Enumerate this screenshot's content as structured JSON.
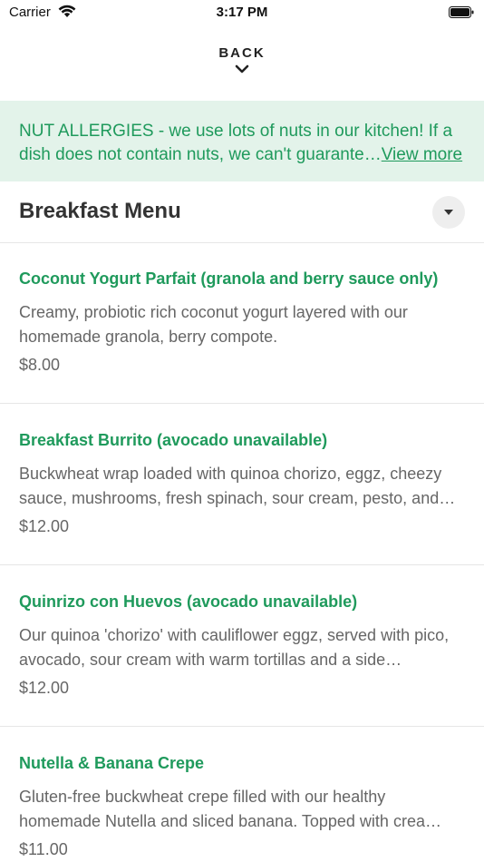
{
  "status_bar": {
    "carrier": "Carrier",
    "time": "3:17 PM"
  },
  "nav": {
    "back_label": "BACK"
  },
  "notice": {
    "text": "NUT ALLERGIES - we use lots of nuts in our kitchen! If a dish does not contain nuts, we can't guarante…",
    "link": "View more"
  },
  "section": {
    "title": "Breakfast Menu"
  },
  "items": [
    {
      "name": "Coconut Yogurt Parfait (granola and berry sauce only)",
      "description": "Creamy, probiotic rich coconut yogurt layered with our homemade granola, berry compote.",
      "price": "$8.00"
    },
    {
      "name": "Breakfast Burrito (avocado unavailable)",
      "description": "Buckwheat wrap loaded with quinoa chorizo, eggz, cheezy sauce, mushrooms, fresh spinach, sour cream, pesto, and…",
      "price": "$12.00"
    },
    {
      "name": "Quinrizo con Huevos (avocado unavailable)",
      "description": "Our quinoa 'chorizo' with cauliflower eggz, served with pico, avocado, sour cream with warm tortillas and a side…",
      "price": "$12.00"
    },
    {
      "name": "Nutella & Banana Crepe",
      "description": "Gluten-free buckwheat crepe filled with our healthy homemade Nutella and sliced banana. Topped with crea…",
      "price": "$11.00"
    }
  ],
  "colors": {
    "accent_green": "#1f9a5c",
    "notice_bg": "#e3f3ea"
  },
  "icons": [
    "wifi-icon",
    "battery-icon",
    "chevron-down-icon",
    "dropdown-triangle-icon"
  ]
}
